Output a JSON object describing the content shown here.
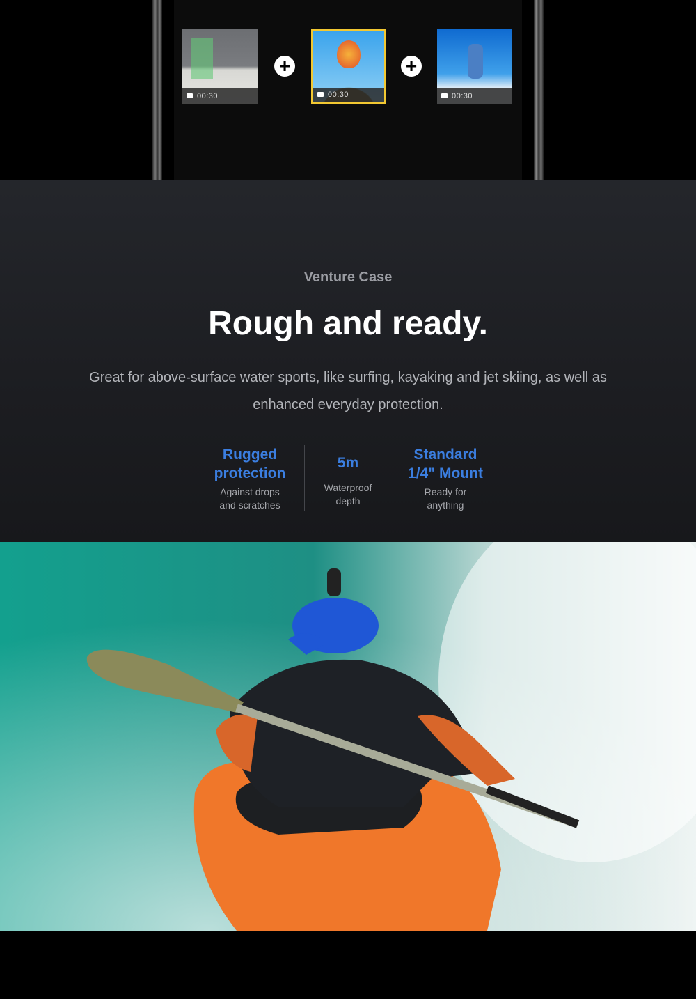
{
  "phone_clips": [
    {
      "duration": "00:30",
      "selected": false
    },
    {
      "duration": "00:30",
      "selected": true
    },
    {
      "duration": "00:30",
      "selected": false
    }
  ],
  "icons": {
    "add": "plus-circle-icon",
    "video": "video-camera-icon"
  },
  "venture": {
    "eyebrow": "Venture Case",
    "title": "Rough and ready.",
    "description": "Great for above-surface water sports, like surfing, kayaking and jet skiing, as well as enhanced everyday protection.",
    "features": [
      {
        "title_line1": "Rugged",
        "title_line2": "protection",
        "sub_line1": "Against drops",
        "sub_line2": "and scratches"
      },
      {
        "title_line1": "5m",
        "title_line2": "",
        "sub_line1": "Waterproof",
        "sub_line2": "depth"
      },
      {
        "title_line1": "Standard",
        "title_line2": "1/4\" Mount",
        "sub_line1": "Ready for",
        "sub_line2": "anything"
      }
    ]
  },
  "colors": {
    "accent": "#3b7ee0",
    "selected_border": "#f2c832"
  }
}
